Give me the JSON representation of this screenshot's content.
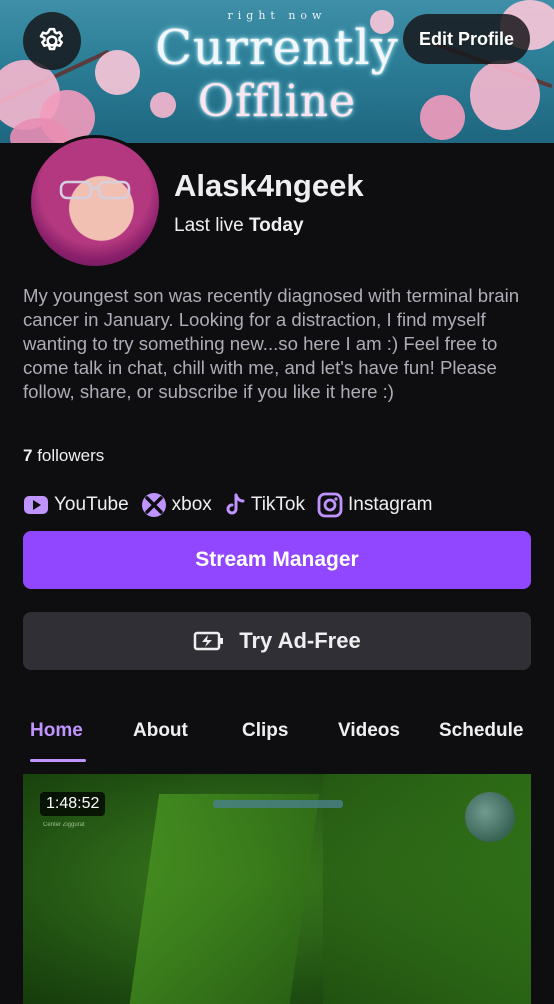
{
  "banner": {
    "small_text": "right now",
    "title_line1": "Currently",
    "title_line2": "Offline"
  },
  "header": {
    "settings_icon": "gear-icon",
    "edit_profile_label": "Edit Profile"
  },
  "profile": {
    "username": "Alask4ngeek",
    "last_live_label": "Last live",
    "last_live_value": "Today",
    "bio": "My youngest son was recently diagnosed with terminal brain cancer in January.  Looking for a distraction, I find myself wanting to try something new...so here I am :) Feel free to come talk in chat, chill with me, and let's have fun! Please follow, share, or subscribe if you like it here :)",
    "followers_count": "7",
    "followers_label": "followers"
  },
  "socials": [
    {
      "label": "YouTube",
      "icon": "youtube-icon"
    },
    {
      "label": "xbox",
      "icon": "xbox-icon"
    },
    {
      "label": "TikTok",
      "icon": "tiktok-icon"
    },
    {
      "label": "Instagram",
      "icon": "instagram-icon"
    }
  ],
  "actions": {
    "stream_manager_label": "Stream Manager",
    "try_ad_free_label": "Try Ad-Free",
    "ad_free_icon": "battery-bolt-icon"
  },
  "tabs": [
    {
      "label": "Home",
      "active": true
    },
    {
      "label": "About",
      "active": false
    },
    {
      "label": "Clips",
      "active": false
    },
    {
      "label": "Videos",
      "active": false
    },
    {
      "label": "Schedule",
      "active": false
    }
  ],
  "video": {
    "duration": "1:48:52",
    "caption": "Center Ziggurat"
  },
  "colors": {
    "accent": "#9147ff",
    "accent_text": "#bf94ff",
    "background": "#0e0e10",
    "button_secondary": "#2f2f35"
  }
}
